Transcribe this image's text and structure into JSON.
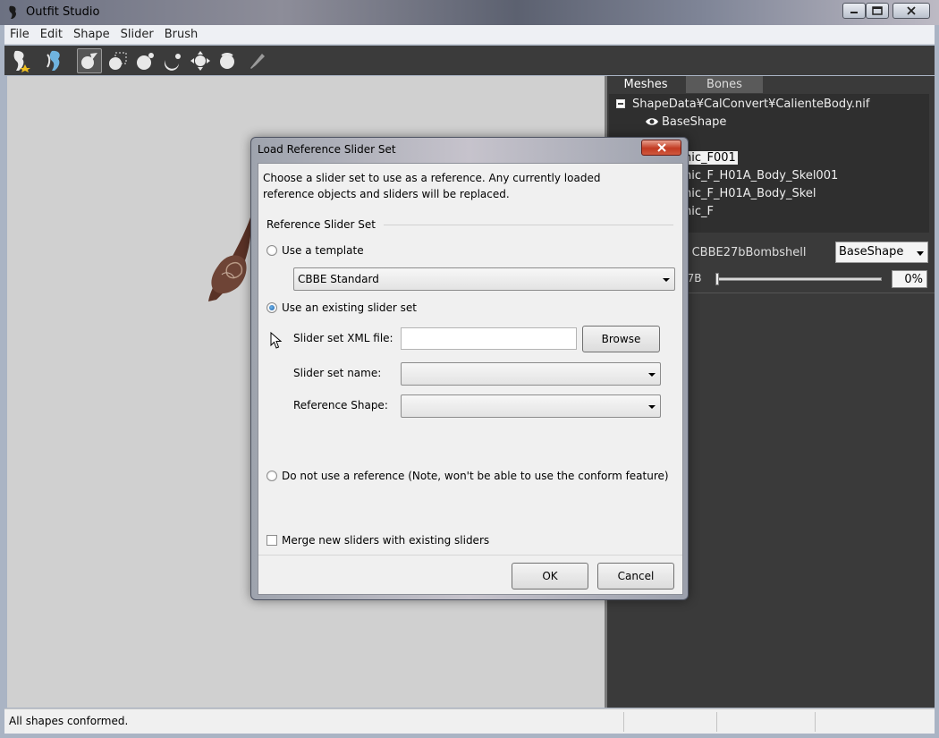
{
  "window": {
    "title": "Outfit Studio"
  },
  "menu": [
    "File",
    "Edit",
    "Shape",
    "Slider",
    "Brush"
  ],
  "toolbar": {
    "tools": [
      "outfit-tool-icon",
      "shape-tool-icon",
      "select-brush-icon",
      "mask-icon",
      "inflate-brush-icon",
      "deflate-brush-icon",
      "move-brush-icon",
      "smooth-brush-icon",
      "weight-brush-icon"
    ]
  },
  "right_panel": {
    "tabs": {
      "meshes": "Meshes",
      "bones": "Bones"
    },
    "tree": {
      "root": "ShapeData¥CalConvert¥CalienteBody.nif",
      "base_shape": "BaseShape",
      "items": [
        "nic_F001",
        "nic_F_H01A_Body_Skel001",
        "nic_F_H01A_Body_Skel",
        "nic_F"
      ]
    },
    "conform_label": "rt CBBE27bBombshell",
    "shape_select": "BaseShape",
    "slider_label": "07B",
    "slider_value": 0,
    "slider_percent": "0%"
  },
  "dialog": {
    "title": "Load Reference Slider Set",
    "description_line1": "Choose a slider set to use as a reference.  Any currently loaded",
    "description_line2": "reference objects and sliders will be replaced.",
    "group_label": "Reference Slider Set",
    "use_template_label": "Use a template",
    "template_value": "CBBE Standard",
    "use_existing_label": "Use an existing slider set",
    "xml_file_label": "Slider set XML file:",
    "xml_file_value": "",
    "browse_label": "Browse",
    "set_name_label": "Slider set name:",
    "set_name_value": "",
    "ref_shape_label": "Reference Shape:",
    "ref_shape_value": "",
    "no_reference_label": "Do not use a reference  (Note, won't be able to use the conform feature)",
    "merge_label": "Merge new sliders with existing sliders",
    "merge_checked": false,
    "ok_label": "OK",
    "cancel_label": "Cancel"
  },
  "status": {
    "text": "All shapes conformed."
  }
}
